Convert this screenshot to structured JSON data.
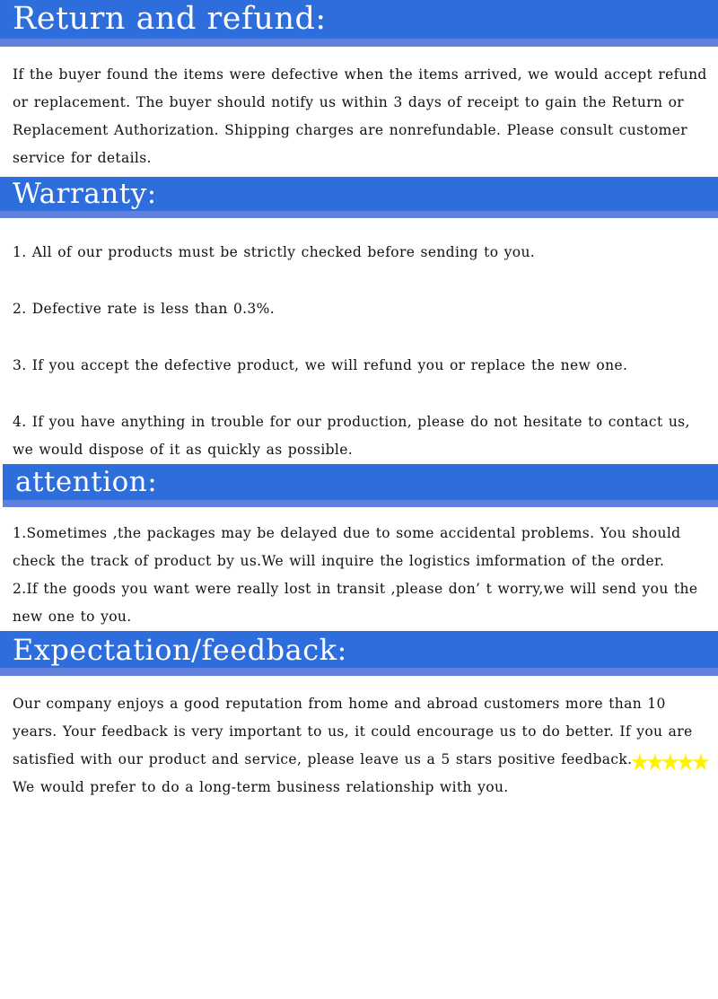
{
  "colors": {
    "header_blue": "#2e6ddc",
    "header_underband": "#6080db",
    "star_yellow": "#fff200",
    "body_text": "#111111",
    "page_background": "#ffffff"
  },
  "sections": [
    {
      "id": "return-and-refund",
      "heading": "Return and refund:",
      "paragraphs": [
        "If the buyer found the items were defective when the items arrived, we would accept refund or replacement. The buyer should notify us within 3 days of receipt to gain the Return or Replacement Authorization. Shipping charges are nonrefundable. Please consult customer service for details."
      ]
    },
    {
      "id": "warranty",
      "heading": "Warranty:",
      "paragraphs": [
        "1. All of our products must be strictly checked before sending to you.",
        "2. Defective rate is less than 0.3%.",
        "3. If you accept the defective product, we will refund you or replace the new one.",
        "4. If you have anything in trouble for our production, please do not hesitate to contact us, we would dispose of it as quickly as possible."
      ]
    },
    {
      "id": "attention",
      "heading": "attention:",
      "paragraphs": [
        "1.Sometimes ,the packages may be delayed due to some accidental problems. You should check the track of product by us.We will inquire the logistics imformation of the order.",
        "2.If the goods you want were really lost in transit ,please don’ t worry,we will send you the new one to you."
      ]
    },
    {
      "id": "expectation-feedback",
      "heading": "Expectation/feedback:",
      "feedback": {
        "text_before_stars": "Our company enjoys a good reputation from home and abroad customers more than 10 years. Your feedback is very important to us, it could encourage us to do better. If you are satisfied with our product and service, please leave us a 5 stars positive feedback.",
        "star_count": 5,
        "text_after_stars": " We would prefer to do a long-term business relationship with you."
      }
    }
  ]
}
